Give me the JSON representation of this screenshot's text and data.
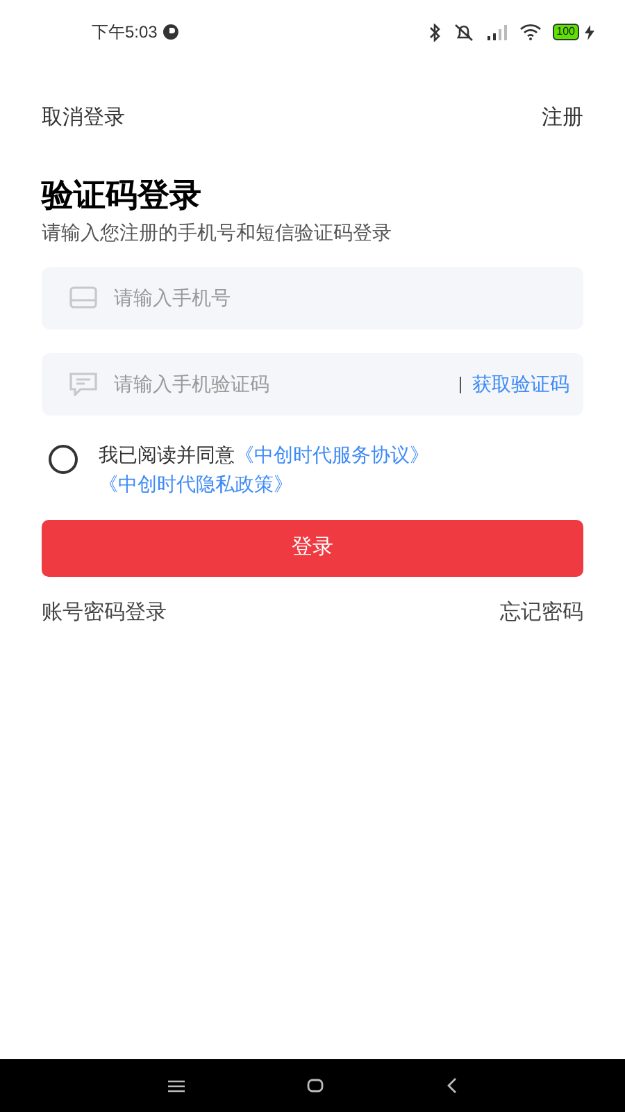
{
  "status_bar": {
    "time": "下午5:03",
    "battery": "100"
  },
  "nav": {
    "cancel": "取消登录",
    "register": "注册"
  },
  "title": "验证码登录",
  "subtitle": "请输入您注册的手机号和短信验证码登录",
  "phone_field": {
    "placeholder": "请输入手机号"
  },
  "code_field": {
    "placeholder": "请输入手机验证码",
    "action": "获取验证码"
  },
  "agreement": {
    "checked": false,
    "text": "我已阅读并同意",
    "links": [
      "《中创时代服务协议》",
      "《中创时代隐私政策》"
    ]
  },
  "login_button": "登录",
  "footer": {
    "password_login": "账号密码登录",
    "forgot_password": "忘记密码"
  }
}
